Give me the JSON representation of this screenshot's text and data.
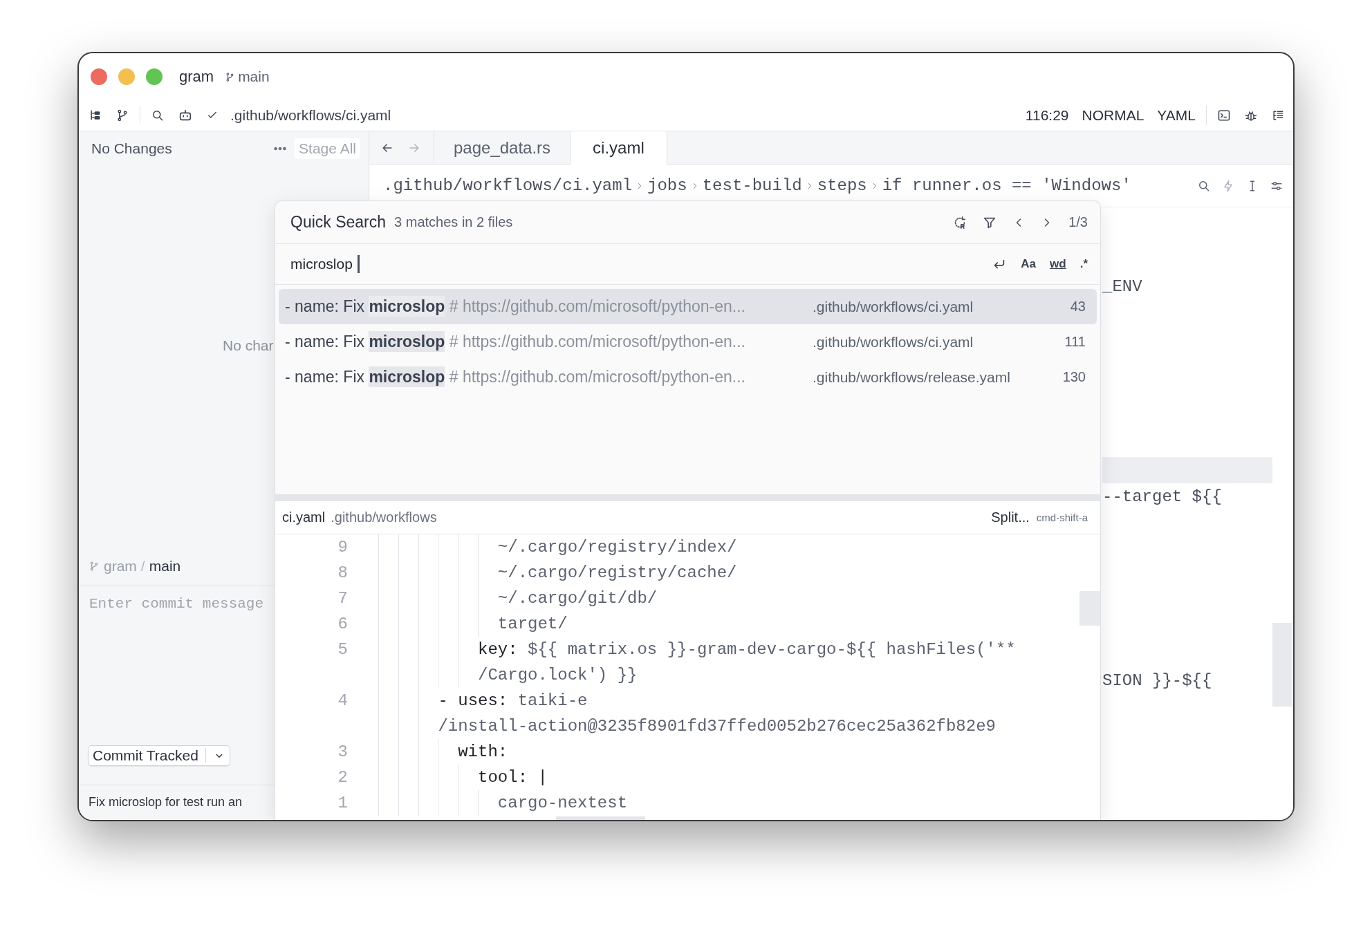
{
  "window": {
    "title": "gram",
    "branch": "main"
  },
  "toolbar": {
    "path": ".github/workflows/ci.yaml",
    "position": "116:29",
    "mode": "NORMAL",
    "language": "YAML"
  },
  "git_panel": {
    "status": "No Changes",
    "stage_all": {
      "label": "Stage All",
      "disabled": true
    },
    "empty_message": "No char",
    "repository": "gram",
    "separator": "/",
    "branch": "main",
    "commit_placeholder": "Enter commit message",
    "commit_button": "Commit Tracked",
    "last_commit": "Fix microslop for test run an"
  },
  "editor": {
    "history": [
      {
        "kind": "back",
        "disabled": false
      },
      {
        "kind": "forward",
        "disabled": true
      }
    ],
    "tabs": [
      {
        "label": "page_data.rs",
        "selected": false
      },
      {
        "label": "ci.yaml",
        "selected": true
      }
    ],
    "breadcrumbs": [
      ".github/workflows/ci.yaml",
      "jobs",
      "test-build",
      "steps",
      "if runner.os == 'Windows'"
    ],
    "lines": [
      {
        "kind": "blank"
      },
      {
        "kind": "code",
        "text": "_ENV"
      },
      {
        "kind": "blank"
      },
      {
        "kind": "blank"
      },
      {
        "kind": "blank"
      },
      {
        "kind": "blank"
      },
      {
        "kind": "blank"
      },
      {
        "kind": "blank"
      },
      {
        "kind": "cursor_line"
      },
      {
        "kind": "code",
        "text": "--target ${{"
      },
      {
        "kind": "blank"
      },
      {
        "kind": "blank"
      },
      {
        "kind": "blank"
      },
      {
        "kind": "blank"
      },
      {
        "kind": "blank"
      },
      {
        "kind": "blank"
      },
      {
        "kind": "code",
        "text": "SION }}-${{"
      }
    ]
  },
  "quick_search": {
    "title": "Quick Search",
    "summary": "3 matches in 2 files",
    "counter": "1/3",
    "query": "microslop",
    "options": [
      {
        "label": "Aa",
        "kind": "case"
      },
      {
        "label": "wd",
        "kind": "word"
      },
      {
        "label": ".*",
        "kind": "regex"
      }
    ],
    "results": [
      {
        "prefix": "- name: Fix",
        "match": "microslop",
        "comment": "# https://github.com/microsoft/python-en...",
        "file": ".github/workflows/ci.yaml",
        "line": "43",
        "selected": true
      },
      {
        "prefix": "- name: Fix",
        "match": "microslop",
        "comment": "# https://github.com/microsoft/python-en...",
        "file": ".github/workflows/ci.yaml",
        "line": "111",
        "selected": false
      },
      {
        "prefix": "- name: Fix",
        "match": "microslop",
        "comment": "# https://github.com/microsoft/python-en...",
        "file": ".github/workflows/release.yaml",
        "line": "130",
        "selected": false
      }
    ],
    "preview": {
      "file": "ci.yaml",
      "directory": ".github/workflows",
      "action": "Split...",
      "shortcut": "cmd-shift-a",
      "lines": [
        {
          "number": "9",
          "parts": [
            {
              "kind": "value",
              "text": "            ~/.cargo/registry/index/"
            }
          ]
        },
        {
          "number": "8",
          "parts": [
            {
              "kind": "value",
              "text": "            ~/.cargo/registry/cache/"
            }
          ]
        },
        {
          "number": "7",
          "parts": [
            {
              "kind": "value",
              "text": "            ~/.cargo/git/db/"
            }
          ]
        },
        {
          "number": "6",
          "parts": [
            {
              "kind": "value",
              "text": "            target/"
            }
          ]
        },
        {
          "number": "5",
          "parts": [
            {
              "kind": "key",
              "text": "          key:"
            },
            {
              "kind": "value",
              "text": " ${{ matrix.os }}-gram-dev-cargo-${{ hashFiles('**"
            }
          ]
        },
        {
          "parts": [
            {
              "kind": "value",
              "text": "          /Cargo.lock') }}"
            }
          ]
        },
        {
          "number": "4",
          "parts": [
            {
              "kind": "key",
              "text": "      - uses:"
            },
            {
              "kind": "value",
              "text": " taiki-e"
            }
          ]
        },
        {
          "parts": [
            {
              "kind": "value",
              "text": "      /install-action@3235f8901fd37ffed0052b276cec25a362fb82e9"
            }
          ]
        },
        {
          "number": "3",
          "parts": [
            {
              "kind": "key",
              "text": "        with:"
            }
          ]
        },
        {
          "number": "2",
          "parts": [
            {
              "kind": "key",
              "text": "          tool: |"
            }
          ]
        },
        {
          "number": "1",
          "parts": [
            {
              "kind": "value",
              "text": "            cargo-nextest"
            }
          ]
        }
      ]
    }
  }
}
